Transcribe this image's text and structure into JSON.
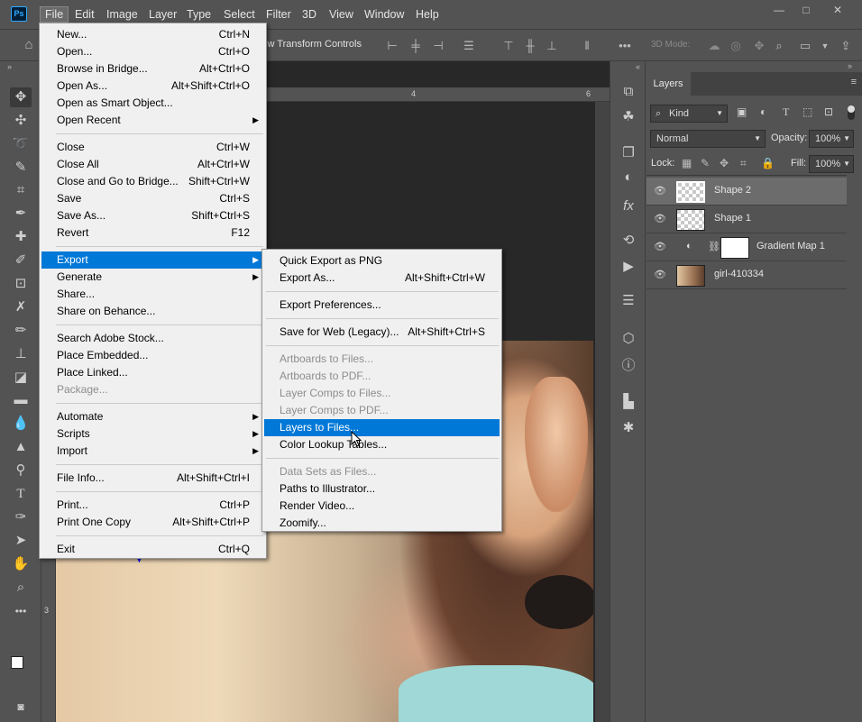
{
  "app": {
    "logo_text": "Ps"
  },
  "menubar": {
    "items": [
      "File",
      "Edit",
      "Image",
      "Layer",
      "Type",
      "Select",
      "Filter",
      "3D",
      "View",
      "Window",
      "Help"
    ],
    "active": "File"
  },
  "window_controls": {
    "minimize": "—",
    "maximize": "□",
    "close": "✕"
  },
  "options_bar": {
    "transform_controls_label": "Show Transform Controls",
    "more": "•••",
    "mode_3d_label": "3D Mode:"
  },
  "rulers": {
    "top": [
      "4",
      "6"
    ],
    "left": [
      "3"
    ]
  },
  "file_menu": {
    "groups": [
      [
        {
          "label": "New...",
          "shortcut": "Ctrl+N"
        },
        {
          "label": "Open...",
          "shortcut": "Ctrl+O"
        },
        {
          "label": "Browse in Bridge...",
          "shortcut": "Alt+Ctrl+O"
        },
        {
          "label": "Open As...",
          "shortcut": "Alt+Shift+Ctrl+O"
        },
        {
          "label": "Open as Smart Object...",
          "shortcut": ""
        },
        {
          "label": "Open Recent",
          "shortcut": "",
          "submenu": true
        }
      ],
      [
        {
          "label": "Close",
          "shortcut": "Ctrl+W"
        },
        {
          "label": "Close All",
          "shortcut": "Alt+Ctrl+W"
        },
        {
          "label": "Close and Go to Bridge...",
          "shortcut": "Shift+Ctrl+W"
        },
        {
          "label": "Save",
          "shortcut": "Ctrl+S"
        },
        {
          "label": "Save As...",
          "shortcut": "Shift+Ctrl+S"
        },
        {
          "label": "Revert",
          "shortcut": "F12"
        }
      ],
      [
        {
          "label": "Export",
          "shortcut": "",
          "submenu": true,
          "highlighted": true
        },
        {
          "label": "Generate",
          "shortcut": "",
          "submenu": true
        },
        {
          "label": "Share...",
          "shortcut": ""
        },
        {
          "label": "Share on Behance...",
          "shortcut": ""
        }
      ],
      [
        {
          "label": "Search Adobe Stock...",
          "shortcut": ""
        },
        {
          "label": "Place Embedded...",
          "shortcut": ""
        },
        {
          "label": "Place Linked...",
          "shortcut": ""
        },
        {
          "label": "Package...",
          "shortcut": "",
          "disabled": true
        }
      ],
      [
        {
          "label": "Automate",
          "shortcut": "",
          "submenu": true
        },
        {
          "label": "Scripts",
          "shortcut": "",
          "submenu": true
        },
        {
          "label": "Import",
          "shortcut": "",
          "submenu": true
        }
      ],
      [
        {
          "label": "File Info...",
          "shortcut": "Alt+Shift+Ctrl+I"
        }
      ],
      [
        {
          "label": "Print...",
          "shortcut": "Ctrl+P"
        },
        {
          "label": "Print One Copy",
          "shortcut": "Alt+Shift+Ctrl+P"
        }
      ],
      [
        {
          "label": "Exit",
          "shortcut": "Ctrl+Q"
        }
      ]
    ]
  },
  "export_submenu": {
    "groups": [
      [
        {
          "label": "Quick Export as PNG",
          "shortcut": ""
        },
        {
          "label": "Export As...",
          "shortcut": "Alt+Shift+Ctrl+W"
        }
      ],
      [
        {
          "label": "Export Preferences...",
          "shortcut": ""
        }
      ],
      [
        {
          "label": "Save for Web (Legacy)...",
          "shortcut": "Alt+Shift+Ctrl+S"
        }
      ],
      [
        {
          "label": "Artboards to Files...",
          "shortcut": "",
          "disabled": true
        },
        {
          "label": "Artboards to PDF...",
          "shortcut": "",
          "disabled": true
        },
        {
          "label": "Layer Comps to Files...",
          "shortcut": "",
          "disabled": true
        },
        {
          "label": "Layer Comps to PDF...",
          "shortcut": "",
          "disabled": true
        },
        {
          "label": "Layers to Files...",
          "shortcut": "",
          "highlighted": true
        },
        {
          "label": "Color Lookup Tables...",
          "shortcut": ""
        }
      ],
      [
        {
          "label": "Data Sets as Files...",
          "shortcut": "",
          "disabled": true
        },
        {
          "label": "Paths to Illustrator...",
          "shortcut": ""
        },
        {
          "label": "Render Video...",
          "shortcut": ""
        },
        {
          "label": "Zoomify...",
          "shortcut": ""
        }
      ]
    ]
  },
  "layers_panel": {
    "tab": "Layers",
    "filter_kind": "Kind",
    "blend_mode": "Normal",
    "opacity_label": "Opacity:",
    "opacity_value": "100%",
    "lock_label": "Lock:",
    "fill_label": "Fill:",
    "fill_value": "100%",
    "layers": [
      {
        "name": "Shape 2",
        "selected": true
      },
      {
        "name": "Shape 1",
        "selected": false
      },
      {
        "name": "Gradient Map 1",
        "selected": false
      },
      {
        "name": "girl-410334",
        "selected": false
      }
    ]
  }
}
